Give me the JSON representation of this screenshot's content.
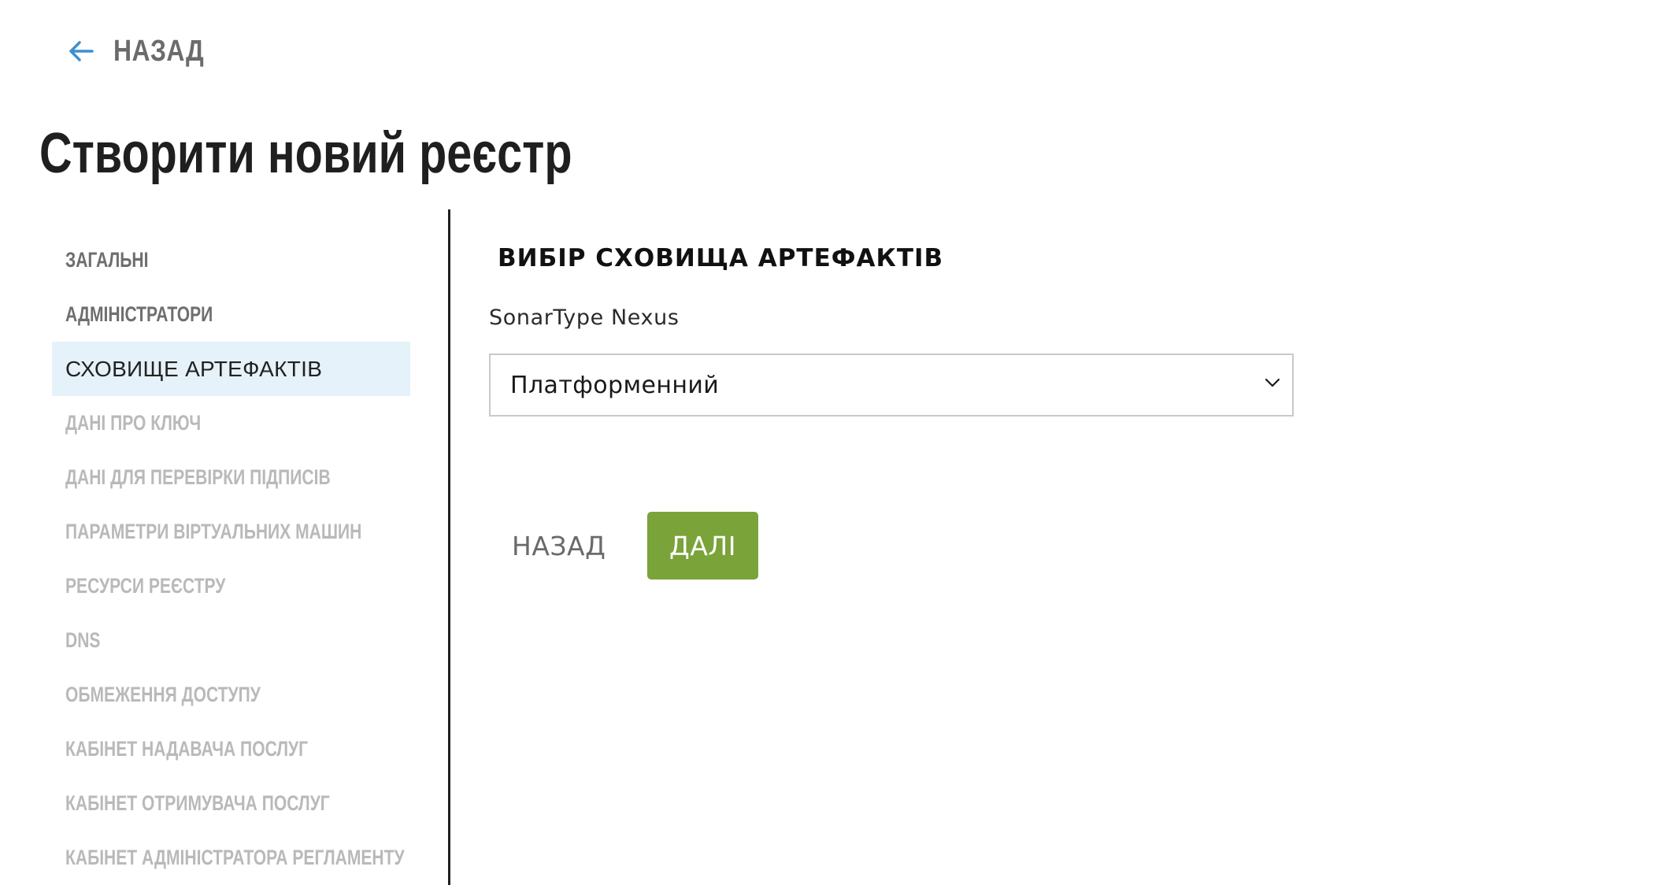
{
  "header": {
    "back_label": "НАЗАД",
    "title": "Створити новий реєстр"
  },
  "sidebar": {
    "items": [
      {
        "label": "ЗАГАЛЬНІ",
        "state": "done"
      },
      {
        "label": "АДМІНІСТРАТОРИ",
        "state": "done"
      },
      {
        "label": "СХОВИЩЕ АРТЕФАКТІВ",
        "state": "active"
      },
      {
        "label": "ДАНІ ПРО КЛЮЧ",
        "state": "pending"
      },
      {
        "label": "ДАНІ ДЛЯ ПЕРЕВІРКИ ПІДПИСІВ",
        "state": "pending"
      },
      {
        "label": "ПАРАМЕТРИ ВІРТУАЛЬНИХ МАШИН",
        "state": "pending"
      },
      {
        "label": "РЕСУРСИ РЕЄСТРУ",
        "state": "pending"
      },
      {
        "label": "DNS",
        "state": "pending"
      },
      {
        "label": "ОБМЕЖЕННЯ ДОСТУПУ",
        "state": "pending"
      },
      {
        "label": "КАБІНЕТ НАДАВАЧА ПОСЛУГ",
        "state": "pending"
      },
      {
        "label": "КАБІНЕТ ОТРИМУВАЧА ПОСЛУГ",
        "state": "pending"
      },
      {
        "label": "КАБІНЕТ АДМІНІСТРАТОРА РЕГЛАМЕНТУ",
        "state": "pending"
      }
    ]
  },
  "main": {
    "section_title": "ВИБІР СХОВИЩА АРТЕФАКТІВ",
    "field_label": "SonarType Nexus",
    "select_value": "Платформенний",
    "buttons": {
      "back_label": "НАЗАД",
      "next_label": "ДАЛІ"
    }
  },
  "colors": {
    "accent_blue": "#3d8fd1",
    "active_bg": "#e6f2f9",
    "primary_green": "#7aa339",
    "done_text": "#6e6e6e",
    "pending_text": "#b9b9b9"
  },
  "icons": {
    "back": "arrow-left-icon",
    "select": "chevron-down-icon"
  }
}
